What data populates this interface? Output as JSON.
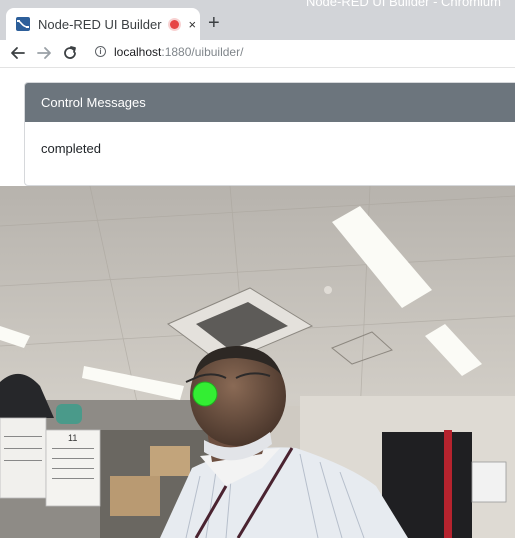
{
  "window": {
    "title": "Node-RED UI Builder - Chromium"
  },
  "tab": {
    "title": "Node-RED UI Builder",
    "close_glyph": "×",
    "new_tab_glyph": "+"
  },
  "address_bar": {
    "host": "localhost",
    "rest": ":1880/uibuilder/"
  },
  "card": {
    "header": "Control Messages",
    "body": "completed"
  },
  "camera": {
    "calendar_month": "11",
    "marker_color": "#33ee33"
  },
  "icons": [
    "node-red-favicon",
    "recording-indicator-icon",
    "close-icon",
    "new-tab-icon",
    "back-arrow-icon",
    "forward-arrow-icon",
    "reload-icon",
    "info-icon"
  ]
}
